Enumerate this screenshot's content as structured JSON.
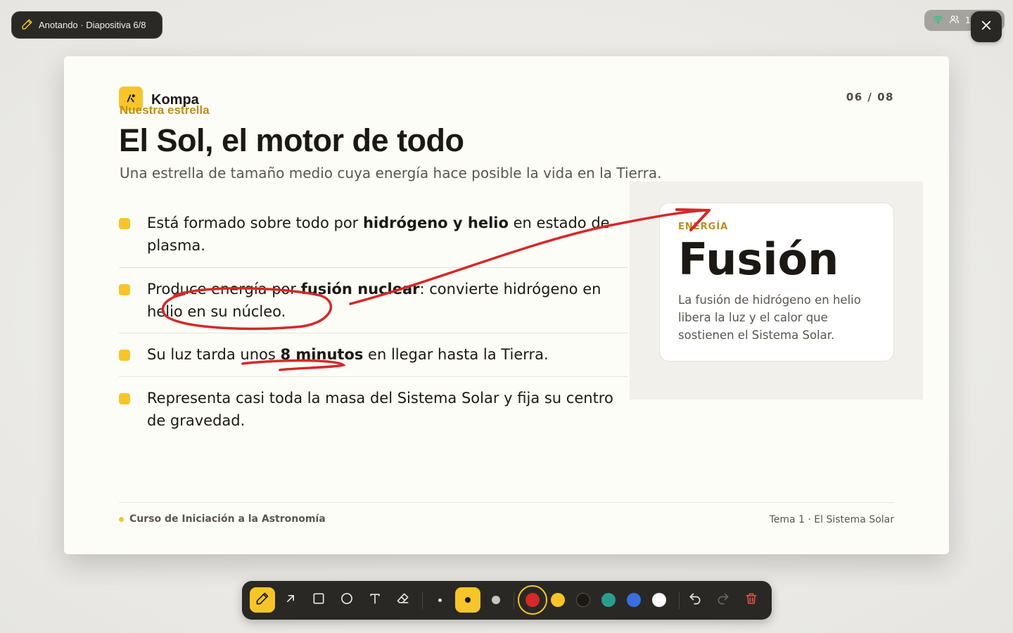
{
  "mode_pill": {
    "label": "Anotando · Diapositiva 6/8"
  },
  "status": {
    "people_count": "12"
  },
  "slide": {
    "brand": "Kompa",
    "counter": "06 / 08",
    "kicker": "Nuestra estrella",
    "title": "El Sol, el motor de todo",
    "subtitle": "Una estrella de tamaño medio cuya energía hace posible la vida en la Tierra.",
    "bullets": [
      {
        "pre": "Está formado sobre todo por ",
        "bold": "hidrógeno y helio",
        "post": " en estado de plasma."
      },
      {
        "pre": "Produce energía por ",
        "bold": "fusión nuclear",
        "post": ": convierte hidrógeno en helio en su núcleo."
      },
      {
        "pre": "Su luz tarda unos ",
        "bold": "8 minutos",
        "post": " en llegar hasta la Tierra."
      },
      {
        "pre": "Representa casi toda la masa del Sistema Solar y fija su centro de gravedad.",
        "bold": "",
        "post": ""
      }
    ],
    "card": {
      "label": "ENERGÍA",
      "title": "Fusión",
      "text": "La fusión de hidrógeno en helio libera la luz y el calor que sostienen el Sistema Solar."
    },
    "footer_left": "Curso de Iniciación a la Astronomía",
    "footer_right": "Tema 1 · El Sistema Solar"
  },
  "toolbar": {
    "tools": [
      "pen-icon",
      "arrow-icon",
      "rectangle-icon",
      "circle-icon",
      "text-icon",
      "eraser-icon"
    ],
    "active_tool": "pen",
    "stroke_sizes": [
      "small",
      "medium",
      "large"
    ],
    "active_size": "medium",
    "colors": [
      "#d62828",
      "#f7c52a",
      "#1c1813",
      "#2a9d8f",
      "#3a6ee0",
      "#ffffff"
    ],
    "active_color": "#d62828"
  },
  "colors": {
    "accent": "#f7c52a",
    "ink": "#d62828",
    "kicker": "#bf8d1a"
  }
}
